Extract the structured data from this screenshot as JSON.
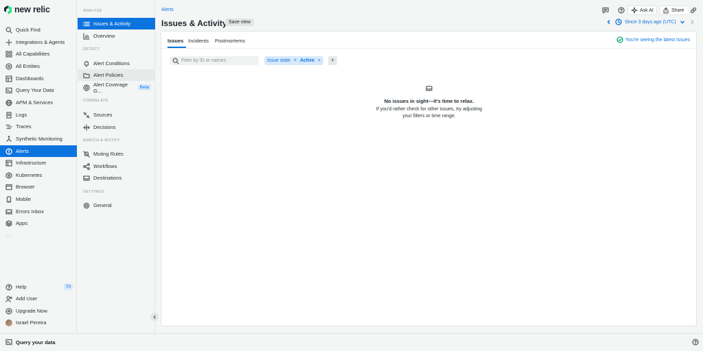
{
  "brand": {
    "name": "new relic"
  },
  "leftnav": {
    "items": [
      {
        "label": "Quick Find",
        "icon": "search-icon"
      },
      {
        "label": "Integrations & Agents",
        "icon": "plus-icon"
      },
      {
        "label": "All Capabilities",
        "icon": "grid-icon"
      },
      {
        "label": "All Entities",
        "icon": "entities-icon"
      },
      {
        "label": "Dashboards",
        "icon": "dashboard-icon"
      },
      {
        "label": "Query Your Data",
        "icon": "query-icon"
      },
      {
        "label": "APM & Services",
        "icon": "globe-icon"
      },
      {
        "label": "Logs",
        "icon": "logs-icon"
      },
      {
        "label": "Traces",
        "icon": "traces-icon"
      },
      {
        "label": "Synthetic Monitoring",
        "icon": "synthetic-icon"
      },
      {
        "label": "Alerts",
        "icon": "alert-icon"
      },
      {
        "label": "Infrastructure",
        "icon": "infrastructure-icon"
      },
      {
        "label": "Kubernetes",
        "icon": "kubernetes-icon"
      },
      {
        "label": "Browser",
        "icon": "browser-icon"
      },
      {
        "label": "Mobile",
        "icon": "mobile-icon"
      },
      {
        "label": "Errors Inbox",
        "icon": "inbox-icon"
      },
      {
        "label": "Apps",
        "icon": "apps-icon"
      }
    ],
    "more": "···",
    "bottom": {
      "help": "Help",
      "help_count": "70",
      "add_user": "Add User",
      "upgrade": "Upgrade Now",
      "user": "Israel Pereira"
    }
  },
  "subnav": {
    "sections": {
      "analyze": "ANALYZE",
      "detect": "DETECT",
      "correlate": "CORRELATE",
      "enrich": "ENRICH & NOTIFY",
      "settings": "SETTINGS"
    },
    "items": {
      "issues_activity": "Issues & Activity",
      "overview": "Overview",
      "alert_conditions": "Alert Conditions",
      "alert_policies": "Alert Policies",
      "alert_coverage": "Alert Coverage G...",
      "beta": "Beta",
      "sources": "Sources",
      "decisions": "Decisions",
      "muting_rules": "Muting Rules",
      "workflows": "Workflows",
      "destinations": "Destinations",
      "general": "General"
    }
  },
  "header": {
    "breadcrumb": "Alerts",
    "title": "Issues & Activity",
    "save_view": "Save view",
    "ask_ai": "Ask AI",
    "share": "Share",
    "time_range": "Since 3 days ago (UTC)"
  },
  "tabs": [
    "Issues",
    "Incidents",
    "Postmortems"
  ],
  "status": {
    "latest": "You're seeing the latest issues"
  },
  "filter": {
    "placeholder": "Filter by ID or names",
    "chip_key": "Issue state",
    "chip_op": "=",
    "chip_value": "Active",
    "chip_remove": "×",
    "add": "+"
  },
  "empty_state": {
    "title": "No issues in sight—it's time to relax.",
    "description": "If you'd rather check for other issues, try adjusting your filters or time range."
  },
  "bottombar": {
    "query_label": "Query your data"
  },
  "colors": {
    "accent": "#0c74df",
    "success": "#11a968"
  }
}
